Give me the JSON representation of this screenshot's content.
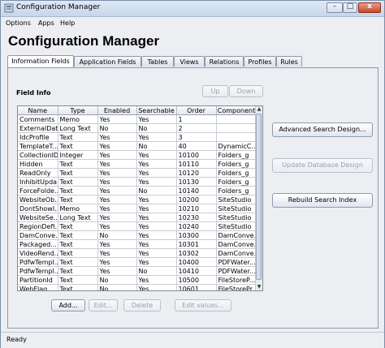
{
  "window": {
    "title": "Configuration Manager"
  },
  "menu": [
    "Options",
    "Apps",
    "Help"
  ],
  "heading": "Configuration Manager",
  "tabs": [
    "Information Fields",
    "Application Fields",
    "Tables",
    "Views",
    "Relations",
    "Profiles",
    "Rules"
  ],
  "panel": {
    "section_label": "Field Info",
    "up_label": "Up",
    "down_label": "Down",
    "columns": [
      "Name",
      "Type",
      "Enabled",
      "Searchable",
      "Order",
      "Component"
    ],
    "rows": [
      [
        "Comments",
        "Memo",
        "Yes",
        "Yes",
        "1",
        ""
      ],
      [
        "ExternalDat...",
        "Long Text",
        "No",
        "No",
        "2",
        ""
      ],
      [
        "IdcProfile",
        "Text",
        "Yes",
        "Yes",
        "3",
        ""
      ],
      [
        "TemplateT...",
        "Text",
        "Yes",
        "No",
        "40",
        "DynamicC..."
      ],
      [
        "CollectionID",
        "Integer",
        "Yes",
        "Yes",
        "10100",
        "Folders_g"
      ],
      [
        "Hidden",
        "Text",
        "Yes",
        "Yes",
        "10110",
        "Folders_g"
      ],
      [
        "ReadOnly",
        "Text",
        "Yes",
        "Yes",
        "10120",
        "Folders_g"
      ],
      [
        "InhibitUpda...",
        "Text",
        "Yes",
        "Yes",
        "10130",
        "Folders_g"
      ],
      [
        "ForceFolde...",
        "Text",
        "Yes",
        "No",
        "10140",
        "Folders_g"
      ],
      [
        "WebsiteOb...",
        "Text",
        "Yes",
        "Yes",
        "10200",
        "SiteStudio"
      ],
      [
        "DontShowI...",
        "Memo",
        "Yes",
        "Yes",
        "10210",
        "SiteStudio"
      ],
      [
        "WebsiteSe...",
        "Long Text",
        "Yes",
        "Yes",
        "10230",
        "SiteStudio"
      ],
      [
        "RegionDefi...",
        "Text",
        "Yes",
        "Yes",
        "10240",
        "SiteStudio"
      ],
      [
        "DamConve...",
        "Text",
        "No",
        "Yes",
        "10300",
        "DamConve..."
      ],
      [
        "Packaged...",
        "Text",
        "Yes",
        "Yes",
        "10301",
        "DamConve..."
      ],
      [
        "VideoRend...",
        "Text",
        "Yes",
        "Yes",
        "10302",
        "DamConve..."
      ],
      [
        "PdfwTempl...",
        "Text",
        "Yes",
        "Yes",
        "10400",
        "PDFWater..."
      ],
      [
        "PdfwTempl...",
        "Text",
        "Yes",
        "No",
        "10410",
        "PDFWater..."
      ],
      [
        "PartitionId",
        "Text",
        "No",
        "Yes",
        "10500",
        "FileStoreP..."
      ],
      [
        "WebFlag",
        "Text",
        "No",
        "Yes",
        "10601",
        "FileStorePr..."
      ]
    ],
    "buttons": {
      "add": "Add...",
      "edit": "Edit...",
      "delete": "Delete",
      "edit_values": "Edit values...",
      "advanced_search": "Advanced Search Design...",
      "update_database": "Update Database Design",
      "rebuild_index": "Rebuild Search Index"
    }
  },
  "status": "Ready"
}
